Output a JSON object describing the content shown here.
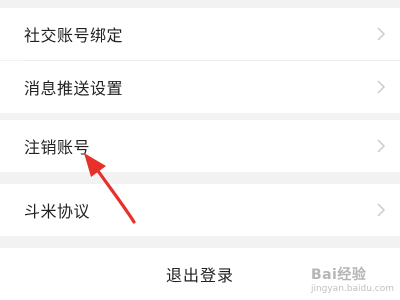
{
  "settings": {
    "items": [
      {
        "label": "社交账号绑定"
      },
      {
        "label": "消息推送设置"
      },
      {
        "label": "注销账号"
      },
      {
        "label": "斗米协议"
      }
    ],
    "logout_label": "退出登录"
  },
  "annotation": {
    "arrow_color": "#e8302a"
  },
  "watermark": {
    "brand": "Bai经验",
    "url": "jingyan.baidu.com"
  },
  "icons": {
    "chevron": "chevron-right-icon",
    "arrow": "red-pointer-arrow"
  }
}
